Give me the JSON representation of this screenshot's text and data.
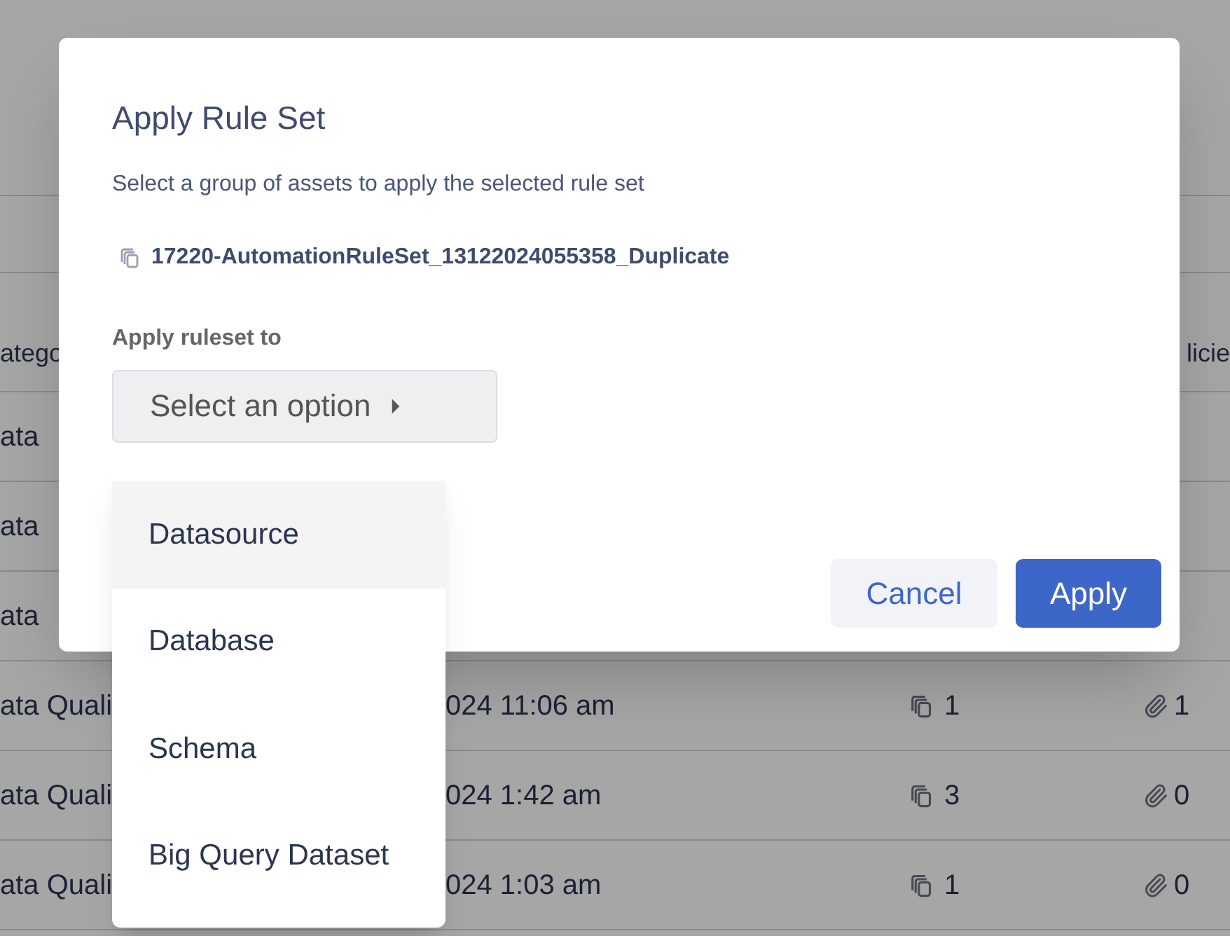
{
  "table": {
    "columns": [
      {
        "label": "atego"
      },
      {
        "label": "licie"
      }
    ],
    "rows": [
      {
        "column_1": "ata"
      },
      {
        "column_1": "ata"
      },
      {
        "column_1": "ata"
      },
      {
        "column_1": "ata Quali",
        "column_2": "024 11:06 am",
        "column_3": "1",
        "column_4": "1"
      },
      {
        "column_1": "ata Quali",
        "column_2": "024 1:42 am",
        "column_3": "3",
        "column_4": "0"
      },
      {
        "column_1": "ata Quali",
        "column_2": "024 1:03 am",
        "column_3": "1",
        "column_4": "0"
      }
    ]
  },
  "dialog": {
    "title": "Apply Rule Set",
    "subtitle": "Select a group of assets to apply the selected rule set",
    "rule_set": "17220-AutomationRuleSet_13122024055358_Duplicate",
    "field_label": "Apply ruleset to",
    "select": {
      "placeholder": "Select an option",
      "expanded": true,
      "options": [
        {
          "label": "Datasource",
          "selected": true
        },
        {
          "label": "Database",
          "selected": false
        },
        {
          "label": "Schema",
          "selected": false
        },
        {
          "label": "Big Query Dataset",
          "selected": false
        }
      ]
    },
    "buttons": [
      {
        "label": "Cancel",
        "kind": "secondary"
      },
      {
        "label": "Apply",
        "kind": "primary"
      }
    ]
  }
}
